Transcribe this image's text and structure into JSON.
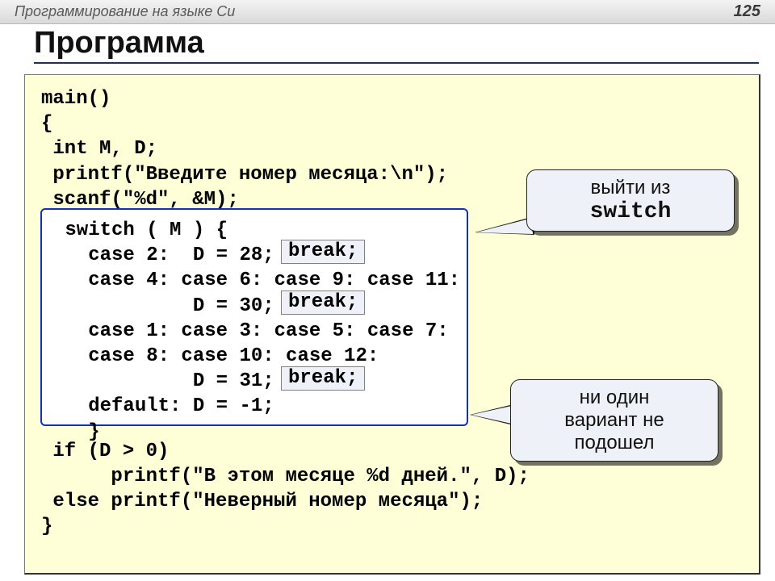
{
  "topbar": {
    "title": "Программирование на языке Си",
    "page": "125"
  },
  "heading": "Программа",
  "code": {
    "before": "main()\n{\n int M, D;\n printf(\"Введите номер месяца:\\n\");\n scanf(\"%d\", &M);",
    "switch_lines": " switch ( M ) {\n   case 2:  D = 28;\n   case 4: case 6: case 9: case 11:\n            D = 30;\n   case 1: case 3: case 5: case 7:\n   case 8: case 10: case 12:\n            D = 31;\n   default: D = -1;\n   }",
    "after": " if (D > 0)\n      printf(\"В этом месяце %d дней.\", D);\n else printf(\"Неверный номер месяца\");\n}"
  },
  "break_label": "break;",
  "callouts": {
    "exit_switch_line1": "выйти из",
    "exit_switch_line2": "switch",
    "no_match": "ни один\nвариант не\nподошел"
  }
}
